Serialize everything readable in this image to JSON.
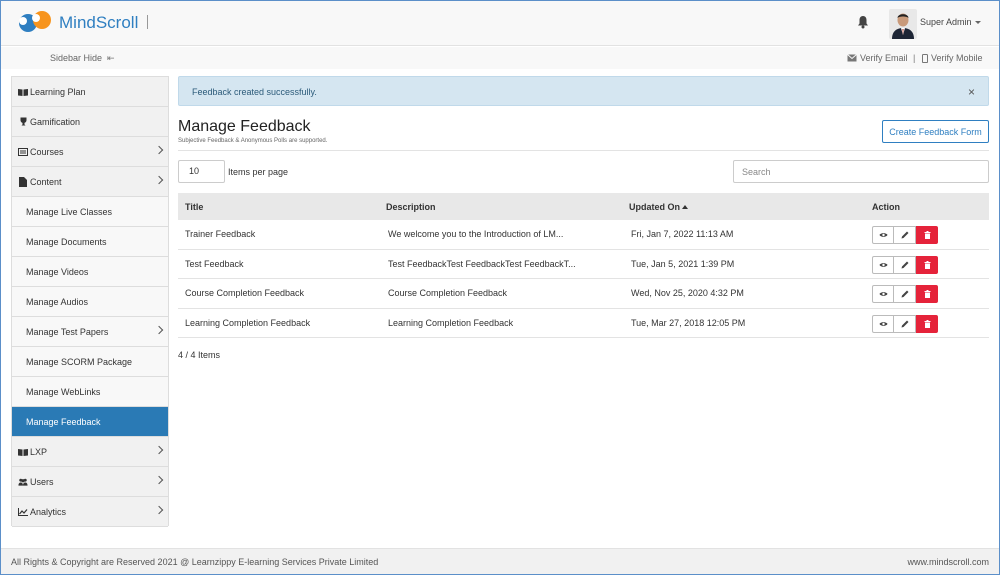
{
  "header": {
    "logo_text": "MindScroll",
    "user_name": "Super Admin"
  },
  "subbar": {
    "sidebar_hide": "Sidebar Hide",
    "verify_email": "Verify Email",
    "separator": "|",
    "verify_mobile": "Verify Mobile"
  },
  "sidebar": {
    "items": [
      {
        "label": "Learning Plan",
        "icon": "book-icon"
      },
      {
        "label": "Gamification",
        "icon": "trophy-icon"
      },
      {
        "label": "Courses",
        "icon": "courses-icon"
      },
      {
        "label": "Content",
        "icon": "file-icon"
      },
      {
        "label": "Manage Live Classes"
      },
      {
        "label": "Manage Documents"
      },
      {
        "label": "Manage Videos"
      },
      {
        "label": "Manage Audios"
      },
      {
        "label": "Manage Test Papers"
      },
      {
        "label": "Manage SCORM Package"
      },
      {
        "label": "Manage WebLinks"
      },
      {
        "label": "Manage Feedback"
      },
      {
        "label": "LXP",
        "icon": "book-icon"
      },
      {
        "label": "Users",
        "icon": "users-icon"
      },
      {
        "label": "Analytics",
        "icon": "chart-icon"
      }
    ]
  },
  "alert": {
    "message": "Feedback created successfully.",
    "close": "×"
  },
  "page": {
    "title": "Manage Feedback",
    "subtitle": "Subjective Feedback & Anonymous Polls are supported.",
    "create_button": "Create Feedback Form",
    "per_page_value": "10",
    "per_page_label": "Items per page",
    "search_placeholder": "Search",
    "count": "4 / 4 Items"
  },
  "table": {
    "columns": {
      "title": "Title",
      "description": "Description",
      "updated": "Updated On",
      "action": "Action"
    },
    "rows": [
      {
        "title": "Trainer Feedback",
        "description": "We welcome you to the Introduction of LM...",
        "updated": "Fri, Jan 7, 2022 11:13 AM"
      },
      {
        "title": "Test Feedback",
        "description": "Test FeedbackTest FeedbackTest FeedbackT...",
        "updated": "Tue, Jan 5, 2021 1:39 PM"
      },
      {
        "title": "Course Completion Feedback",
        "description": "Course Completion Feedback",
        "updated": "Wed, Nov 25, 2020 4:32 PM"
      },
      {
        "title": "Learning Completion Feedback",
        "description": "Learning Completion Feedback",
        "updated": "Tue, Mar 27, 2018 12:05 PM"
      }
    ]
  },
  "footer": {
    "copyright": "All Rights & Copyright are Reserved 2021 @ Learnzippy E-learning Services Private Limited",
    "site": "www.mindscroll.com"
  },
  "colors": {
    "brand": "#2f7fc1",
    "active": "#2a7ab5",
    "danger": "#e5233a",
    "alert_bg": "#d5e6f1"
  }
}
